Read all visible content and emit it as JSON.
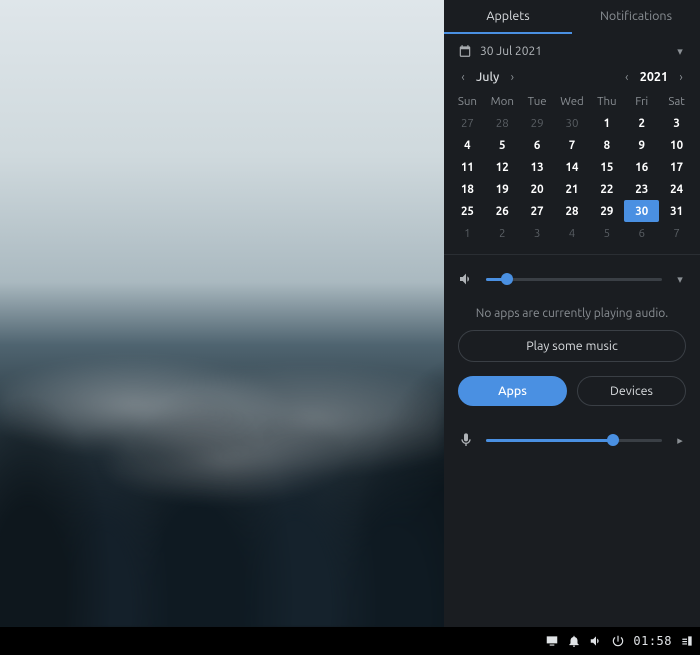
{
  "tabs": {
    "applets": "Applets",
    "notifications": "Notifications"
  },
  "date_header": "30 Jul 2021",
  "month_nav": {
    "label": "July"
  },
  "year_nav": {
    "label": "2021"
  },
  "dow": [
    "Sun",
    "Mon",
    "Tue",
    "Wed",
    "Thu",
    "Fri",
    "Sat"
  ],
  "weeks": [
    [
      {
        "d": "27",
        "m": "out"
      },
      {
        "d": "28",
        "m": "out"
      },
      {
        "d": "29",
        "m": "out"
      },
      {
        "d": "30",
        "m": "out"
      },
      {
        "d": "1",
        "m": "in"
      },
      {
        "d": "2",
        "m": "in"
      },
      {
        "d": "3",
        "m": "in"
      }
    ],
    [
      {
        "d": "4",
        "m": "in"
      },
      {
        "d": "5",
        "m": "in"
      },
      {
        "d": "6",
        "m": "in"
      },
      {
        "d": "7",
        "m": "in"
      },
      {
        "d": "8",
        "m": "in"
      },
      {
        "d": "9",
        "m": "in"
      },
      {
        "d": "10",
        "m": "in"
      }
    ],
    [
      {
        "d": "11",
        "m": "in"
      },
      {
        "d": "12",
        "m": "in"
      },
      {
        "d": "13",
        "m": "in"
      },
      {
        "d": "14",
        "m": "in"
      },
      {
        "d": "15",
        "m": "in"
      },
      {
        "d": "16",
        "m": "in"
      },
      {
        "d": "17",
        "m": "in"
      }
    ],
    [
      {
        "d": "18",
        "m": "in"
      },
      {
        "d": "19",
        "m": "in"
      },
      {
        "d": "20",
        "m": "in"
      },
      {
        "d": "21",
        "m": "in"
      },
      {
        "d": "22",
        "m": "in"
      },
      {
        "d": "23",
        "m": "in"
      },
      {
        "d": "24",
        "m": "in"
      }
    ],
    [
      {
        "d": "25",
        "m": "in"
      },
      {
        "d": "26",
        "m": "in"
      },
      {
        "d": "27",
        "m": "in"
      },
      {
        "d": "28",
        "m": "in"
      },
      {
        "d": "29",
        "m": "in"
      },
      {
        "d": "30",
        "m": "sel"
      },
      {
        "d": "31",
        "m": "in"
      }
    ],
    [
      {
        "d": "1",
        "m": "out"
      },
      {
        "d": "2",
        "m": "out"
      },
      {
        "d": "3",
        "m": "out"
      },
      {
        "d": "4",
        "m": "out"
      },
      {
        "d": "5",
        "m": "out"
      },
      {
        "d": "6",
        "m": "out"
      },
      {
        "d": "7",
        "m": "out"
      }
    ]
  ],
  "volume_percent": 12,
  "mic_percent": 72,
  "audio": {
    "noapps_text": "No apps are currently playing audio.",
    "play_label": "Play some music",
    "apps_label": "Apps",
    "devices_label": "Devices"
  },
  "taskbar": {
    "time": "01:58"
  }
}
